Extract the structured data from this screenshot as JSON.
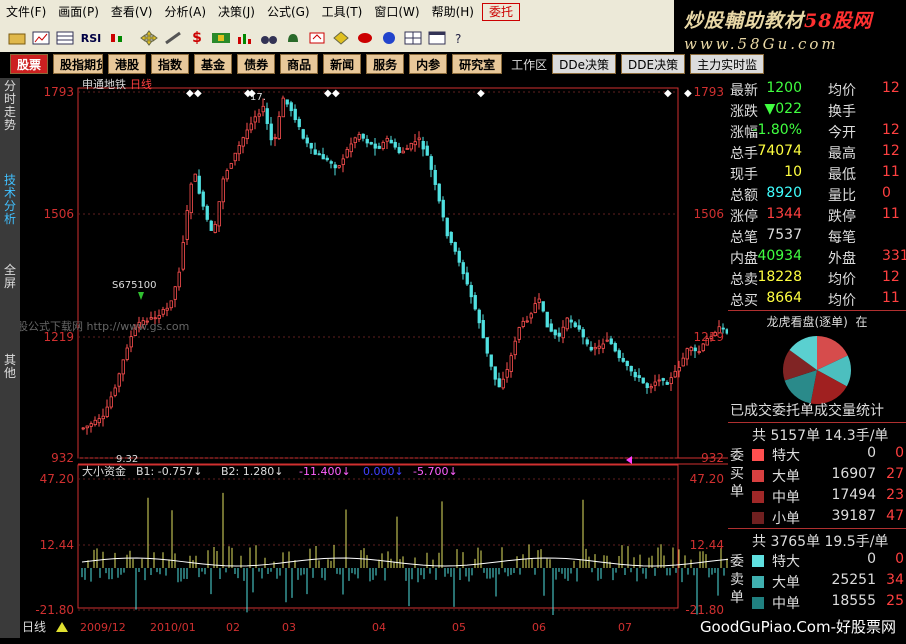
{
  "menu": {
    "items": [
      "文件(F)",
      "画面(P)",
      "查看(V)",
      "分析(A)",
      "决策(J)",
      "公式(G)",
      "工具(T)",
      "窗口(W)",
      "帮助(H)"
    ],
    "highlight": "委托"
  },
  "brand": {
    "line1_a": "炒股輔助教材",
    "line1_b": "58股网",
    "line2": "www.58Gu.com"
  },
  "toolbar": {
    "icons": [
      "open-folder-icon",
      "chart-icon",
      "table-icon",
      "rsi-icon",
      "kline-icon",
      "move-icon",
      "draw-icon",
      "money-icon",
      "flag-icon",
      "bars-icon",
      "binoculars-icon",
      "bell-icon",
      "news-icon",
      "diamond-icon",
      "link-icon",
      "globe-icon",
      "grid-icon",
      "window-icon",
      "help-icon"
    ],
    "rsi_label": "RSI",
    "dollar_label": "$"
  },
  "tabs": {
    "items": [
      "股票",
      "股指期货",
      "港股",
      "指数",
      "基金",
      "债券",
      "商品",
      "新闻",
      "服务",
      "内参",
      "研究室"
    ],
    "active": "股票",
    "workarea": "工作区",
    "right": [
      "DDe决策",
      "DDE决策",
      "主力实时监"
    ]
  },
  "left_tabs": [
    "分时走势",
    "技术分析",
    "全屏",
    "其他"
  ],
  "chart": {
    "stock_name": "申通地铁",
    "period": "日线",
    "y_labels": [
      "1793",
      "1506",
      "1219",
      "932"
    ],
    "sub_y_labels": [
      "47.20",
      "12.44",
      "-21.80"
    ],
    "high_label": "17.",
    "low_label": "9.32",
    "buy_signal": "S675100",
    "indicator_label": "大小资金",
    "indicator_values": [
      {
        "text": "B1: -0.757↓",
        "color": "#dddddd"
      },
      {
        "text": "B2: 1.280↓",
        "color": "#dddddd"
      },
      {
        "text": "-11.400↓",
        "color": "#ff60ff"
      },
      {
        "text": "0.000↓",
        "color": "#4040ff"
      },
      {
        "text": "-5.700↓",
        "color": "#ff60ff"
      }
    ],
    "watermark_text": "炒股公式下载网 http://www.gs.com",
    "x_labels": [
      "2009/12",
      "2010/01",
      "02",
      "03",
      "04",
      "05",
      "06",
      "07"
    ],
    "bottom_period": "日线"
  },
  "quote": {
    "rows": [
      {
        "l1": "最新",
        "v1": "1200",
        "c1": "#40ff40",
        "l2": "均价",
        "v2": "12"
      },
      {
        "l1": "涨跌",
        "v1": "▼022",
        "c1": "#40ff40",
        "l2": "换手",
        "v2": ""
      },
      {
        "l1": "涨幅",
        "v1": "-1.80%",
        "c1": "#40ff40",
        "l2": "今开",
        "v2": "12"
      },
      {
        "l1": "总手",
        "v1": "74074",
        "c1": "#ffff40",
        "l2": "最高",
        "v2": "12"
      },
      {
        "l1": "现手",
        "v1": "10",
        "c1": "#ffff40",
        "l2": "最低",
        "v2": "11"
      },
      {
        "l1": "总额",
        "v1": "8920",
        "c1": "#40ffff",
        "l2": "量比",
        "v2": "0"
      },
      {
        "l1": "涨停",
        "v1": "1344",
        "c1": "#ff4040",
        "l2": "跌停",
        "v2": "11"
      },
      {
        "l1": "总笔",
        "v1": "7537",
        "c1": "#dddddd",
        "l2": "每笔",
        "v2": ""
      },
      {
        "l1": "内盘",
        "v1": "40934",
        "c1": "#40ff40",
        "l2": "外盘",
        "v2": "331"
      },
      {
        "l1": "总卖",
        "v1": "18228",
        "c1": "#ffff40",
        "l2": "均价",
        "v2": "12"
      },
      {
        "l1": "总买",
        "v1": "8664",
        "c1": "#ffff40",
        "l2": "均价",
        "v2": "11"
      }
    ]
  },
  "dragon": {
    "title": "龙虎看盘(逐单)",
    "extra": "在",
    "pie_colors": [
      "#d64c4c",
      "#4cbfbf",
      "#a02020",
      "#2a8a8a",
      "#802424",
      "#5ad0d0"
    ]
  },
  "orders": {
    "title": "已成交委托单成交量统计",
    "buy": {
      "vert": "委买单",
      "head": "共 5157单 14.3手/单",
      "rows": [
        {
          "label": "特大",
          "v1": "0",
          "v2": "0",
          "color": "#ff5050"
        },
        {
          "label": "大单",
          "v1": "16907",
          "v2": "27",
          "color": "#d84040"
        },
        {
          "label": "中单",
          "v1": "17494",
          "v2": "23",
          "color": "#a02828"
        },
        {
          "label": "小单",
          "v1": "39187",
          "v2": "47",
          "color": "#702020"
        }
      ]
    },
    "sell": {
      "vert": "委卖单",
      "head": "共 3765单 19.5手/单",
      "rows": [
        {
          "label": "特大",
          "v1": "0",
          "v2": "0",
          "color": "#60e0e0"
        },
        {
          "label": "大单",
          "v1": "25251",
          "v2": "34",
          "color": "#40b0b0"
        },
        {
          "label": "中单",
          "v1": "18555",
          "v2": "25",
          "color": "#208080"
        }
      ]
    }
  },
  "footer_watermark": "GoodGuPiao.Com-好股票网"
}
